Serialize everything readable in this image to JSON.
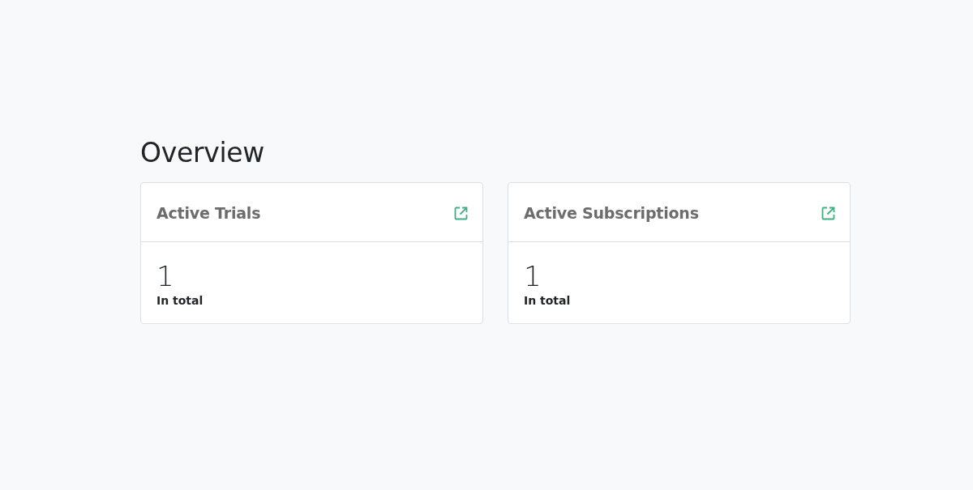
{
  "page": {
    "title": "Overview"
  },
  "cards": [
    {
      "title": "Active Trials",
      "value": "1",
      "caption": "In total"
    },
    {
      "title": "Active Subscriptions",
      "value": "1",
      "caption": "In total"
    }
  ]
}
